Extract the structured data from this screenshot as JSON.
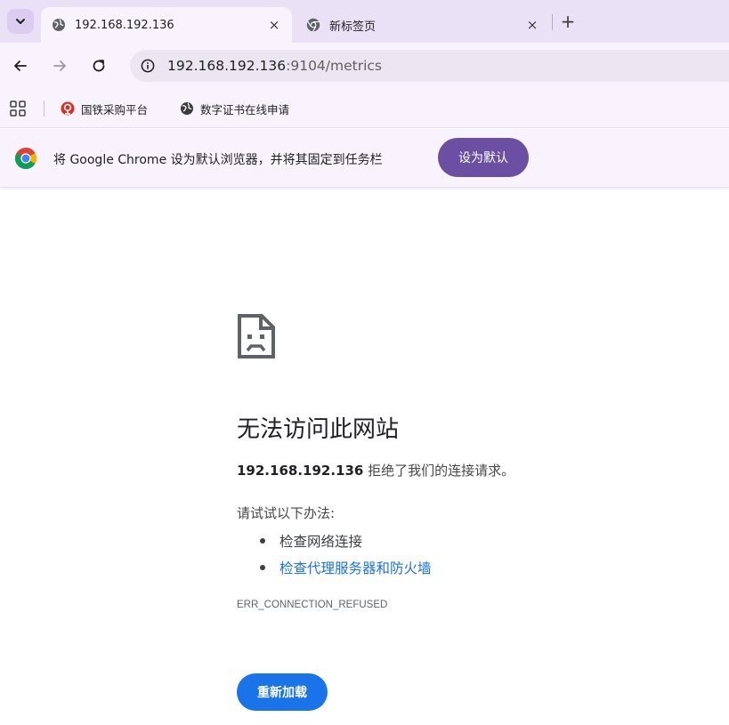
{
  "colors": {
    "tabstrip_bg": "#ebe1f7",
    "toolbar_bg": "#f8f3fc",
    "infobar_button_bg": "#6b4fa3",
    "reload_button_bg": "#1a73e8",
    "link_color": "#1a73e8"
  },
  "tabs": [
    {
      "title": "192.168.192.136",
      "icon": "globe-icon",
      "active": true,
      "close": "×"
    },
    {
      "title": "新标签页",
      "icon": "chrome-icon",
      "active": false,
      "close": "×"
    }
  ],
  "new_tab_label": "+",
  "address_bar": {
    "url_host": "192.168.192.136",
    "url_rest": ":9104/metrics"
  },
  "bookmarks": [
    {
      "label": "国铁采购平台",
      "icon": "railway-icon"
    },
    {
      "label": "数字证书在线申请",
      "icon": "globe-icon"
    }
  ],
  "infobar": {
    "message": "将 Google Chrome 设为默认浏览器，并将其固定到任务栏",
    "button_label": "设为默认"
  },
  "error": {
    "title": "无法访问此网站",
    "host": "192.168.192.136",
    "description": "拒绝了我们的连接请求。",
    "suggestions_title": "请试试以下办法:",
    "suggestions": [
      {
        "text": "检查网络连接",
        "is_link": false
      },
      {
        "text": "检查代理服务器和防火墙",
        "is_link": true
      }
    ],
    "code": "ERR_CONNECTION_REFUSED",
    "reload_label": "重新加载"
  }
}
